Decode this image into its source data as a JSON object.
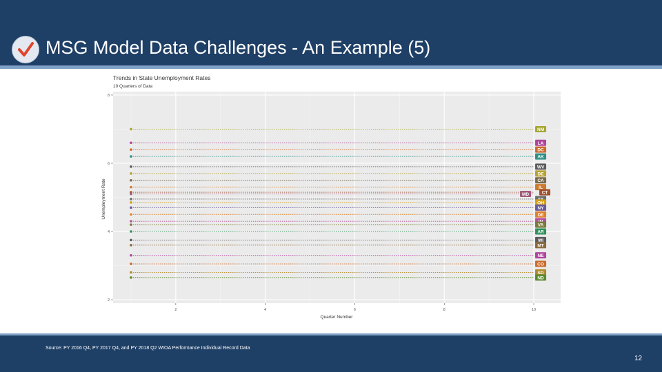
{
  "slide": {
    "title": "MSG Model Data Challenges - An Example (5)",
    "source": "Source: PY 2016 Q4, PY 2017 Q4, and PY 2018 Q2 WIOA Performance Individual Record Data",
    "page_number": "12",
    "check_icon": "checkmark-icon",
    "colors": {
      "header": "#1e3f66",
      "accent_line": "#7fa2c6",
      "check": "#e0452c"
    }
  },
  "chart_data": {
    "type": "line",
    "title": "Trends in State Unemployment Rates",
    "subtitle": "10 Quarters of Data",
    "xlabel": "Quarter Number",
    "ylabel": "Unemployment Rate",
    "x_ticks": [
      "2",
      "4",
      "6",
      "8",
      "10"
    ],
    "y_ticks": [
      "2",
      "4",
      "6",
      "8"
    ],
    "xlim": [
      0.6,
      10.6
    ],
    "ylim": [
      1.9,
      8.1
    ],
    "grid": true,
    "series": [
      {
        "name": "NM",
        "x": [
          1,
          10
        ],
        "values": [
          7.0,
          7.0
        ],
        "color": "#a6a633"
      },
      {
        "name": "LA",
        "x": [
          1,
          10
        ],
        "values": [
          6.6,
          6.6
        ],
        "color": "#b0449c"
      },
      {
        "name": "DC",
        "x": [
          1,
          10
        ],
        "values": [
          6.4,
          6.4
        ],
        "color": "#cc6a2b"
      },
      {
        "name": "AK",
        "x": [
          1,
          10
        ],
        "values": [
          6.2,
          6.2
        ],
        "color": "#2f8f86"
      },
      {
        "name": "WV",
        "x": [
          1,
          10
        ],
        "values": [
          5.9,
          5.9
        ],
        "color": "#5b5b5b"
      },
      {
        "name": "DE",
        "x": [
          1,
          10
        ],
        "values": [
          5.7,
          5.7
        ],
        "color": "#b7a233"
      },
      {
        "name": "CA",
        "x": [
          1,
          10
        ],
        "values": [
          5.5,
          5.5
        ],
        "color": "#7a6a4a"
      },
      {
        "name": "IL",
        "x": [
          1,
          10
        ],
        "values": [
          5.3,
          5.3
        ],
        "color": "#cc7a2b"
      },
      {
        "name": "CT",
        "x": [
          1,
          10
        ],
        "values": [
          5.15,
          5.15
        ],
        "color": "#a0522d"
      },
      {
        "name": "MD",
        "x": [
          1,
          10
        ],
        "values": [
          5.1,
          5.1
        ],
        "color": "#a05a7a"
      },
      {
        "name": "TX",
        "x": [
          1,
          10
        ],
        "values": [
          4.95,
          4.95
        ],
        "color": "#6b6b6b"
      },
      {
        "name": "OH",
        "x": [
          1,
          10
        ],
        "values": [
          4.85,
          4.85
        ],
        "color": "#d4a017"
      },
      {
        "name": "NY",
        "x": [
          1,
          10
        ],
        "values": [
          4.7,
          4.7
        ],
        "color": "#6a5a9a"
      },
      {
        "name": "DE",
        "x": [
          1,
          10
        ],
        "values": [
          4.5,
          4.5
        ],
        "color": "#e0802b"
      },
      {
        "name": "IN",
        "x": [
          1,
          10
        ],
        "values": [
          4.3,
          4.3
        ],
        "color": "#b44c9c"
      },
      {
        "name": "VA",
        "x": [
          1,
          10
        ],
        "values": [
          4.2,
          4.2
        ],
        "color": "#7a7a3a"
      },
      {
        "name": "AR",
        "x": [
          1,
          10
        ],
        "values": [
          4.0,
          4.0
        ],
        "color": "#2f8f5b"
      },
      {
        "name": "WI",
        "x": [
          1,
          10
        ],
        "values": [
          3.75,
          3.75
        ],
        "color": "#5b5b5b"
      },
      {
        "name": "MT",
        "x": [
          1,
          10
        ],
        "values": [
          3.6,
          3.6
        ],
        "color": "#8b6a3a"
      },
      {
        "name": "NE",
        "x": [
          1,
          10
        ],
        "values": [
          3.3,
          3.3
        ],
        "color": "#b0449c"
      },
      {
        "name": "CO",
        "x": [
          1,
          10
        ],
        "values": [
          3.05,
          3.05
        ],
        "color": "#cc6a2b"
      },
      {
        "name": "SD",
        "x": [
          1,
          10
        ],
        "values": [
          2.8,
          2.8
        ],
        "color": "#b08a2b"
      },
      {
        "name": "ND",
        "x": [
          1,
          10
        ],
        "values": [
          2.65,
          2.65
        ],
        "color": "#5a8a2b"
      }
    ]
  }
}
